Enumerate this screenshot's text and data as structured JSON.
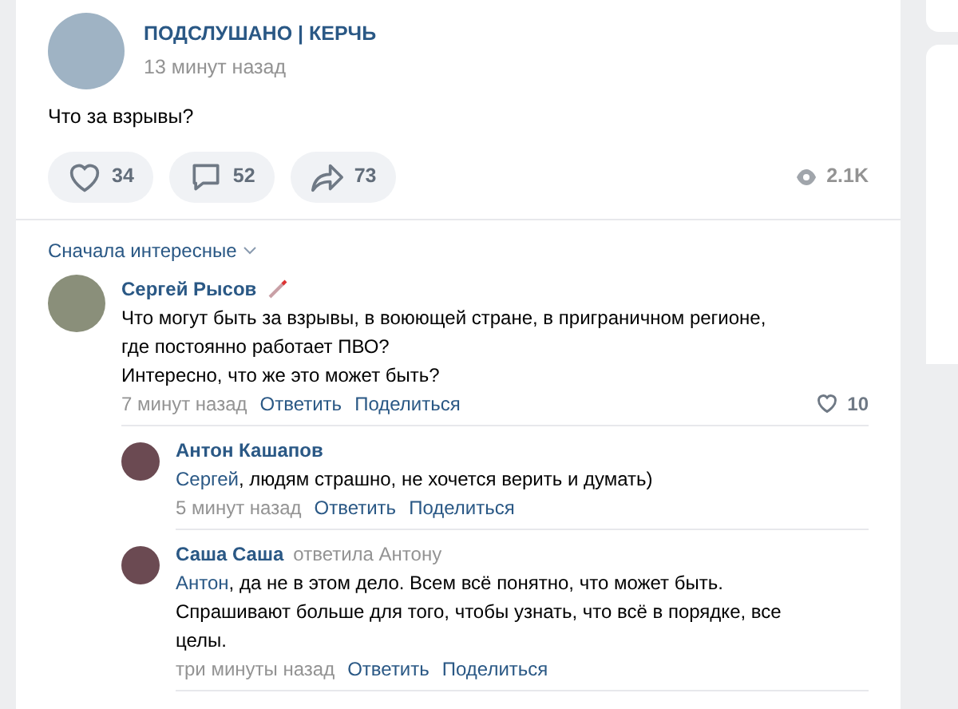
{
  "post": {
    "author": "ПОДСЛУШАНО | КЕРЧЬ",
    "time": "13 минут назад",
    "text": "Что за взрывы?",
    "actions": [
      {
        "kind": "like",
        "count": "34"
      },
      {
        "kind": "comment",
        "count": "52"
      },
      {
        "kind": "share",
        "count": "73"
      }
    ],
    "views": "2.1K"
  },
  "comments": {
    "sort": "Сначала интересные",
    "items": [
      {
        "author": "Сергей Рысов",
        "badge": true,
        "text": "Что могут быть за взрывы, в воюющей стране, в приграничном регионе,\nгде постоянно работает ПВО?\nИнтересно, что же это может быть?",
        "time": "7 минут назад",
        "actions": [
          "Ответить",
          "Поделиться"
        ],
        "likes": "10",
        "replies": [
          {
            "author": "Антон Кашапов",
            "mention": "Сергей",
            "text": ", людям страшно, не хочется верить и думать)",
            "time": "5 минут назад",
            "actions": [
              "Ответить",
              "Поделиться"
            ]
          },
          {
            "author": "Саша Саша",
            "reply_to": "ответила Антону",
            "mention": "Антон",
            "text": ", да не в этом дело. Всем всё понятно, что может быть.\nСпрашивают больше для того, чтобы узнать, что всё в порядке, все\nцелы.",
            "time": "три минуты назад",
            "actions": [
              "Ответить",
              "Поделиться"
            ]
          }
        ]
      }
    ]
  }
}
